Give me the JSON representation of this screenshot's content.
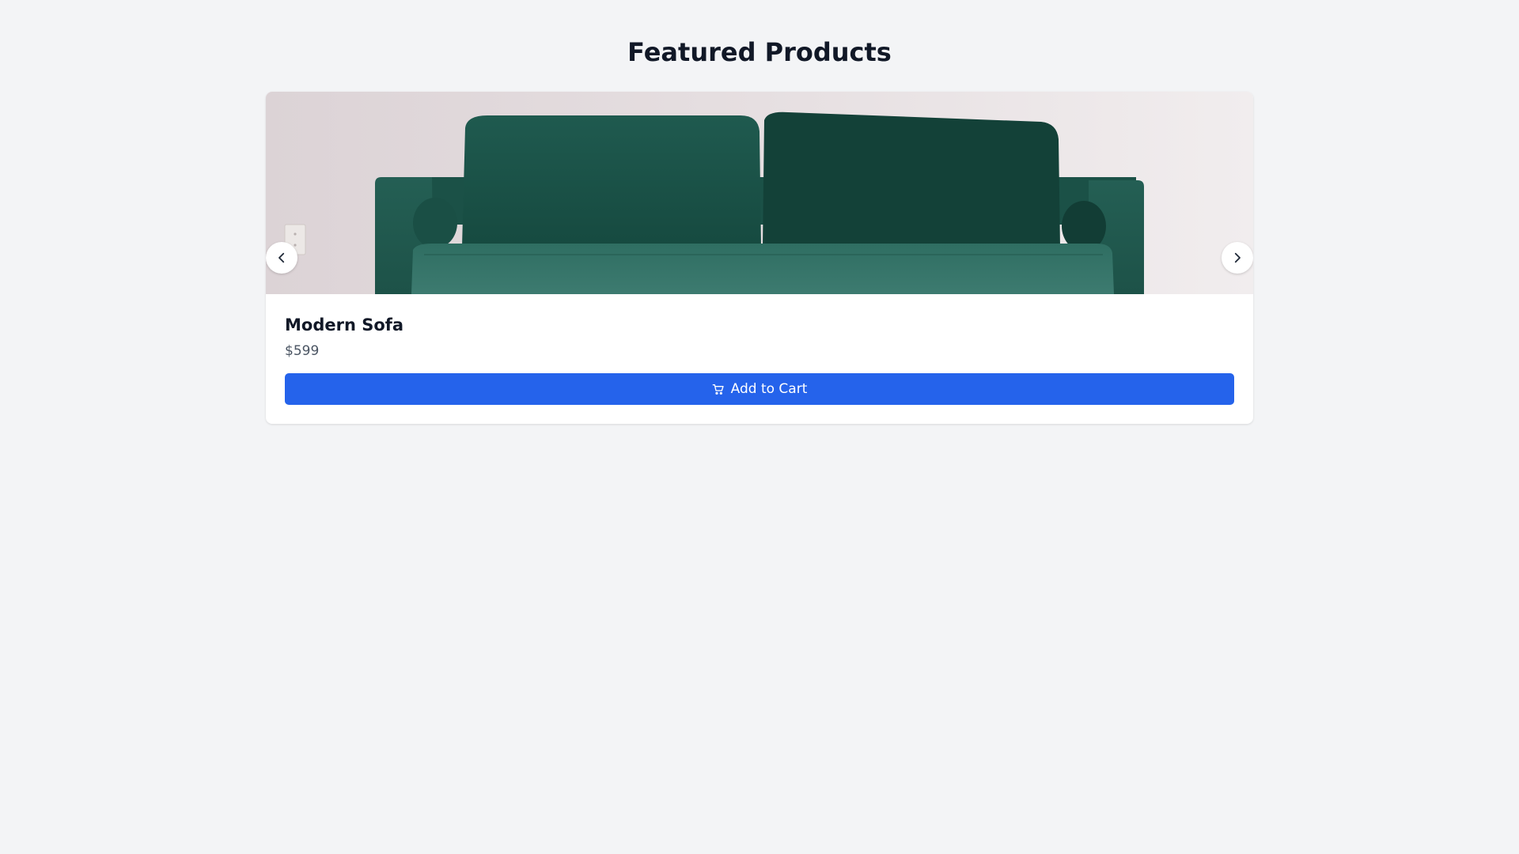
{
  "page": {
    "title": "Featured Products"
  },
  "carousel": {
    "prev_icon": "chevron-left-icon",
    "next_icon": "chevron-right-icon"
  },
  "product": {
    "name": "Modern Sofa",
    "price": "$599",
    "image": "green-velvet-sofa-photo"
  },
  "cart_button": {
    "label": "Add to Cart",
    "icon": "shopping-cart-icon",
    "color": "#2563eb"
  },
  "colors": {
    "background": "#f3f4f6",
    "card": "#ffffff",
    "accent": "#2563eb",
    "title_text": "#111827",
    "price_text": "#4b5563"
  }
}
